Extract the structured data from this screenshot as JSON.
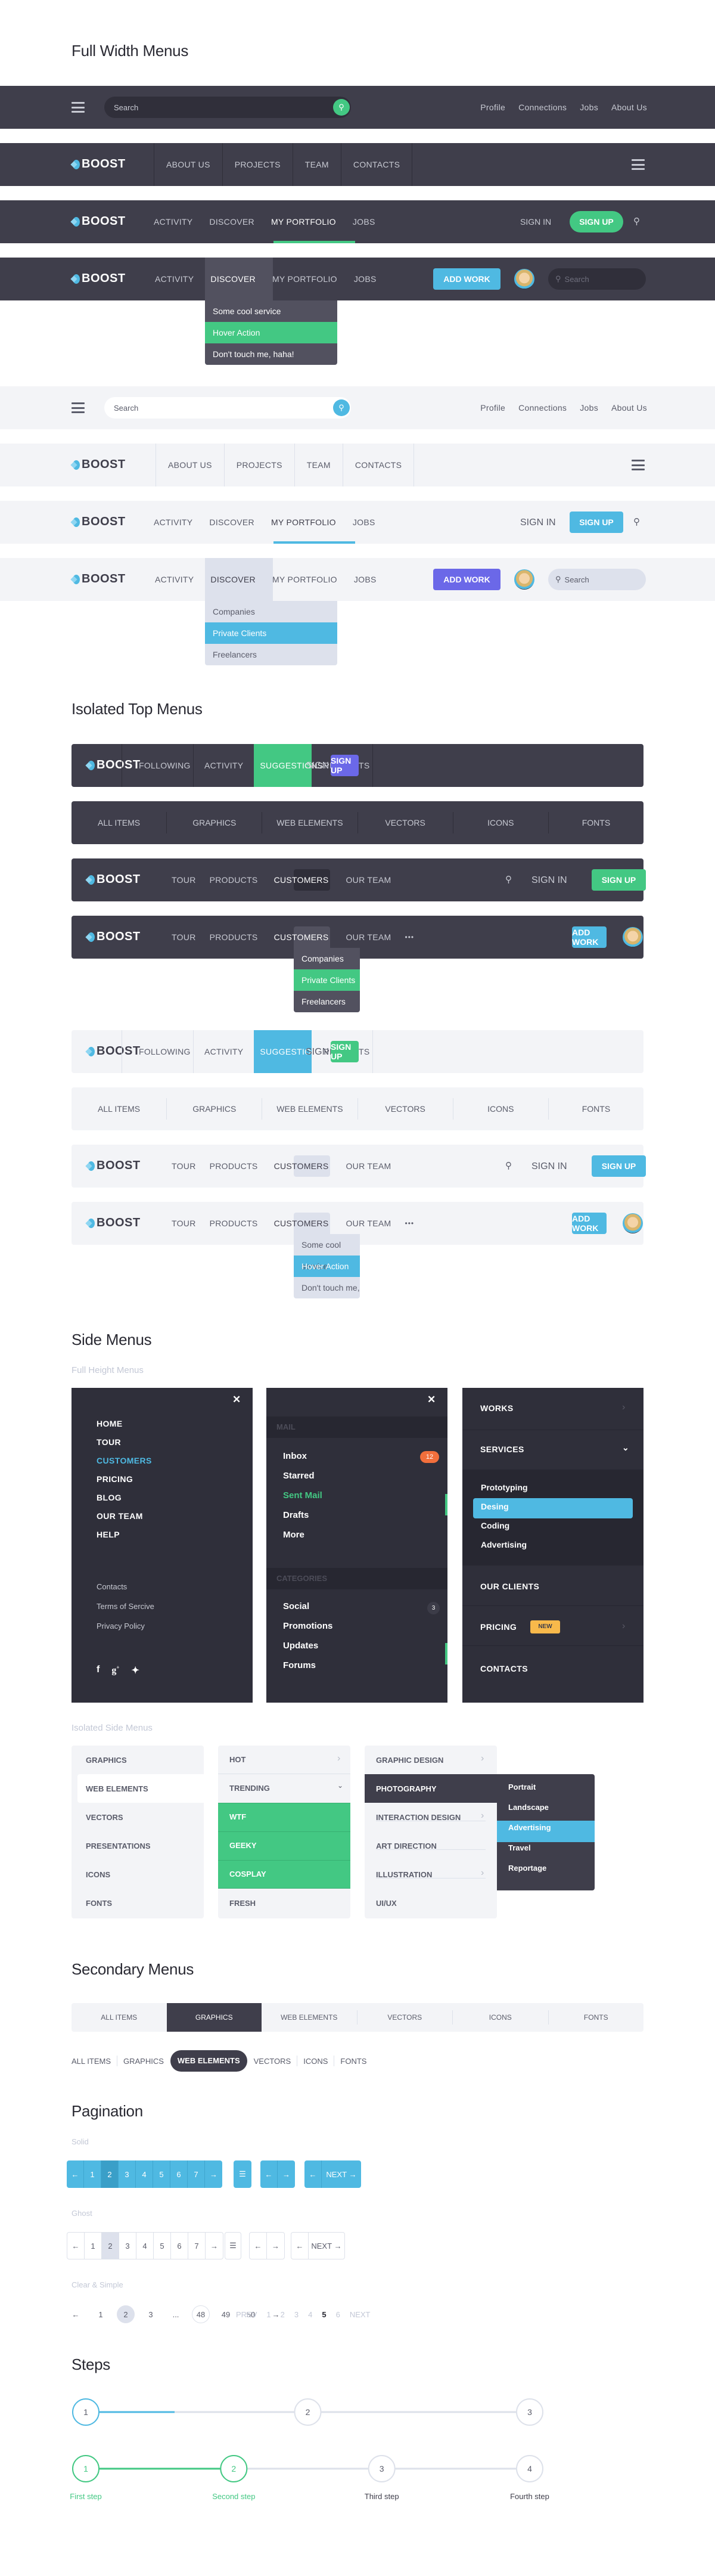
{
  "sections": {
    "full_width": "Full Width Menus",
    "isolated_top": "Isolated Top Menus",
    "side": "Side Menus",
    "side_full_height": "Full Height Menus",
    "side_isolated": "Isolated Side Menus",
    "secondary": "Secondary Menus",
    "pagination": "Pagination",
    "pag_solid": "Solid",
    "pag_ghost": "Ghost",
    "pag_clear": "Clear & Simple",
    "steps": "Steps"
  },
  "brand": "BOOST",
  "colors": {
    "dark": "#3f3e4b",
    "light": "#f3f4f7",
    "green": "#43c883",
    "blue": "#4fb9e2",
    "purple": "#6b68e8",
    "orange": "#f26f3c",
    "yellow": "#f8b94b"
  },
  "fw1": {
    "search_placeholder": "Search",
    "links": [
      "Profile",
      "Connections",
      "Jobs",
      "About Us"
    ]
  },
  "fw2": {
    "links": [
      "ABOUT US",
      "PROJECTS",
      "TEAM",
      "CONTACTS"
    ]
  },
  "fw3": {
    "links": [
      "ACTIVITY",
      "DISCOVER",
      "MY PORTFOLIO",
      "JOBS"
    ],
    "active": "MY PORTFOLIO",
    "signin": "SIGN IN",
    "signup": "SIGN UP"
  },
  "fw4": {
    "links": [
      "ACTIVITY",
      "DISCOVER",
      "MY PORTFOLIO",
      "JOBS"
    ],
    "open": "DISCOVER",
    "add_work": "ADD WORK",
    "search_placeholder": "Search",
    "dropdown": [
      "Some cool service",
      "Hover Action",
      "Don't touch me, haha!"
    ],
    "hover": "Hover Action"
  },
  "fw8": {
    "dropdown": [
      "Companies",
      "Private Clients",
      "Freelancers"
    ],
    "hover": "Private Clients"
  },
  "it1": {
    "links": [
      "FOLLOWING",
      "ACTIVITY",
      "SUGGESTIONS",
      "PROJECTS"
    ],
    "active": "SUGGESTIONS",
    "signin": "SIGN IN",
    "signup": "SIGN UP"
  },
  "it2": {
    "links": [
      "ALL ITEMS",
      "GRAPHICS",
      "WEB ELEMENTS",
      "VECTORS",
      "ICONS",
      "FONTS"
    ]
  },
  "it3": {
    "links": [
      "TOUR",
      "PRODUCTS",
      "CUSTOMERS",
      "OUR TEAM"
    ],
    "active": "CUSTOMERS",
    "signin": "SIGN IN",
    "signup": "SIGN UP"
  },
  "it4": {
    "links": [
      "TOUR",
      "PRODUCTS",
      "CUSTOMERS",
      "OUR TEAM"
    ],
    "open": "CUSTOMERS",
    "add_work": "ADD WORK",
    "more": "•••",
    "dropdown": [
      "Companies",
      "Private Clients",
      "Freelancers"
    ],
    "hover": "Private Clients"
  },
  "it8": {
    "dropdown": [
      "Some cool service",
      "Hover Action",
      "Don't touch me, haha!"
    ],
    "hover": "Hover Action"
  },
  "side1": {
    "items": [
      "HOME",
      "TOUR",
      "CUSTOMERS",
      "PRICING",
      "BLOG",
      "OUR TEAM",
      "HELP"
    ],
    "active": "CUSTOMERS",
    "footer": [
      "Contacts",
      "Terms of Sercive",
      "Privacy Policy"
    ],
    "social": [
      "facebook",
      "google-plus",
      "twitter"
    ]
  },
  "side2": {
    "mail_header": "MAIL",
    "mail": [
      "Inbox",
      "Starred",
      "Sent Mail",
      "Drafts",
      "More"
    ],
    "inbox_badge": "12",
    "active": "Sent Mail",
    "cat_header": "CATEGORIES",
    "cats": [
      "Social",
      "Promotions",
      "Updates",
      "Forums"
    ],
    "social_badge": "3",
    "active_cat": "Updates"
  },
  "side3": {
    "items": [
      "WORKS",
      "SERVICES",
      "OUR CLIENTS",
      "PRICING",
      "CONTACTS"
    ],
    "sub": [
      "Prototyping",
      "Desing",
      "Coding",
      "Advertising"
    ],
    "active_sub": "Desing",
    "badge": "NEW"
  },
  "iso1": {
    "items": [
      "GRAPHICS",
      "WEB ELEMENTS",
      "VECTORS",
      "PRESENTATIONS",
      "ICONS",
      "FONTS"
    ],
    "active": "WEB ELEMENTS"
  },
  "iso2": {
    "items": [
      "HOT",
      "TRENDING",
      "WTF",
      "GEEKY",
      "COSPLAY",
      "FRESH"
    ],
    "green": [
      "WTF",
      "GEEKY",
      "COSPLAY"
    ]
  },
  "iso3": {
    "items": [
      "GRAPHIC DESIGN",
      "PHOTOGRAPHY",
      "INTERACTION DESIGN",
      "ART DIRECTION",
      "ILLUSTRATION",
      "UI/UX"
    ],
    "active": "PHOTOGRAPHY",
    "flyout": [
      "Portrait",
      "Landscape",
      "Advertising",
      "Travel",
      "Reportage"
    ],
    "flyout_active": "Advertising"
  },
  "sec1": {
    "items": [
      "ALL ITEMS",
      "GRAPHICS",
      "WEB ELEMENTS",
      "VECTORS",
      "ICONS",
      "FONTS"
    ],
    "active": "GRAPHICS"
  },
  "sec2": {
    "items": [
      "ALL ITEMS",
      "GRAPHICS",
      "WEB ELEMENTS",
      "VECTORS",
      "ICONS",
      "FONTS"
    ],
    "active": "WEB ELEMENTS"
  },
  "pag": {
    "pages": [
      "1",
      "2",
      "3",
      "4",
      "5",
      "6",
      "7"
    ],
    "current": "2",
    "next": "NEXT",
    "prev_arrow": "←",
    "next_arrow": "→",
    "menu": "☰"
  },
  "pag_clear": {
    "pages": [
      "1",
      "2",
      "3",
      "...",
      "48",
      "49",
      "50"
    ],
    "current": "2",
    "outlined": "48",
    "prev": "PREV",
    "next": "NEXT",
    "pages2": [
      "1",
      "2",
      "3",
      "4",
      "5",
      "6"
    ],
    "current2": "5"
  },
  "steps1": {
    "steps": [
      "1",
      "2",
      "3"
    ],
    "current": 1,
    "progress_to_next": 0.4
  },
  "steps2": {
    "steps": [
      "1",
      "2",
      "3",
      "4"
    ],
    "labels": [
      "First step",
      "Second step",
      "Third step",
      "Fourth step"
    ],
    "completed": 2
  }
}
